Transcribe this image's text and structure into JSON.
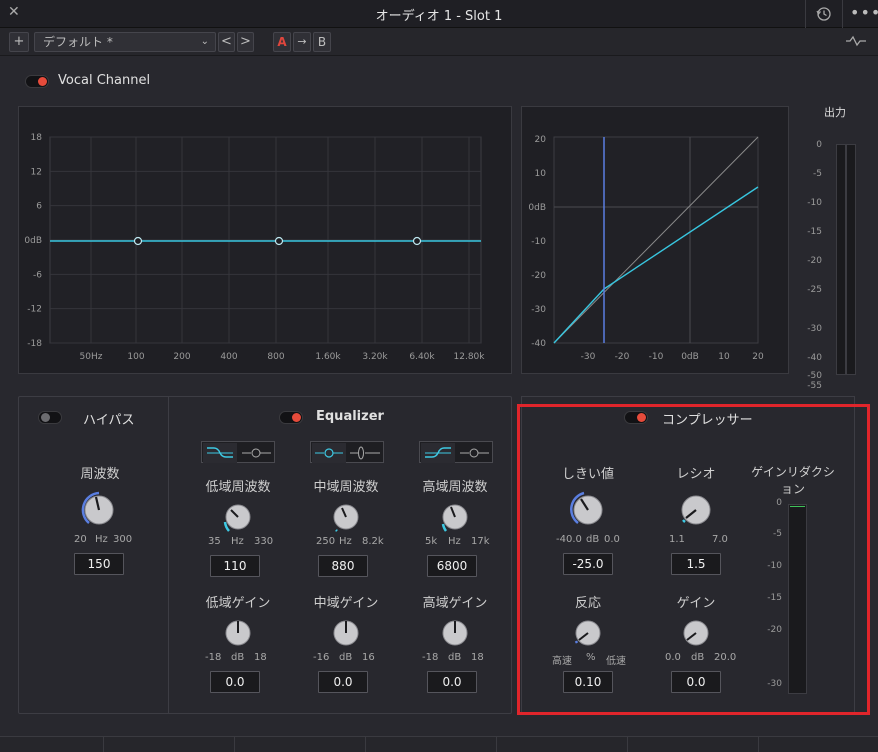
{
  "window": {
    "title": "オーディオ 1 - Slot 1"
  },
  "toolbar": {
    "add_label": "+",
    "preset_value": "デフォルト *",
    "prev_label": "<",
    "next_label": ">",
    "a_label": "A",
    "copy_label": "→",
    "b_label": "B"
  },
  "channel": {
    "name": "Vocal Channel",
    "enabled": true
  },
  "eq_graph": {
    "y_ticks": [
      "18",
      "12",
      "6",
      "0dB",
      "-6",
      "-12",
      "-18"
    ],
    "x_ticks": [
      "50Hz",
      "100",
      "200",
      "400",
      "800",
      "1.60k",
      "3.20k",
      "6.40k",
      "12.80k"
    ]
  },
  "comp_graph": {
    "y_ticks": [
      "20",
      "10",
      "0dB",
      "-10",
      "-20",
      "-30",
      "-40"
    ],
    "x_ticks": [
      "-30",
      "-20",
      "-10",
      "0dB",
      "10",
      "20"
    ]
  },
  "output_meter": {
    "label": "出力",
    "scale": [
      "0",
      "-5",
      "-10",
      "-15",
      "-20",
      "-25",
      "-30",
      "-40",
      "-50",
      "-55"
    ]
  },
  "highpass": {
    "title": "ハイパス",
    "enabled": false,
    "freq_label": "周波数",
    "min": "20",
    "unit": "Hz",
    "max": "300",
    "value": "150"
  },
  "equalizer": {
    "title": "Equalizer",
    "enabled": true,
    "bands": [
      {
        "freq_label": "低域周波数",
        "freq_min": "35",
        "freq_unit": "Hz",
        "freq_max": "330",
        "freq_value": "110",
        "gain_label": "低域ゲイン",
        "gain_min": "-18",
        "gain_unit": "dB",
        "gain_max": "18",
        "gain_value": "0.0"
      },
      {
        "freq_label": "中域周波数",
        "freq_min": "250",
        "freq_unit": "Hz",
        "freq_max": "8.2k",
        "freq_value": "880",
        "gain_label": "中域ゲイン",
        "gain_min": "-16",
        "gain_unit": "dB",
        "gain_max": "16",
        "gain_value": "0.0"
      },
      {
        "freq_label": "高域周波数",
        "freq_min": "5k",
        "freq_unit": "Hz",
        "freq_max": "17k",
        "freq_value": "6800",
        "gain_label": "高域ゲイン",
        "gain_min": "-18",
        "gain_unit": "dB",
        "gain_max": "18",
        "gain_value": "0.0"
      }
    ]
  },
  "compressor": {
    "title": "コンプレッサー",
    "enabled": true,
    "threshold": {
      "label": "しきい値",
      "min": "-40.0",
      "unit": "dB",
      "max": "0.0",
      "value": "-25.0"
    },
    "ratio": {
      "label": "レシオ",
      "min": "1.1",
      "max": "7.0",
      "value": "1.5"
    },
    "response": {
      "label": "反応",
      "min": "高速",
      "unit": "%",
      "max": "低速",
      "value": "0.10"
    },
    "gain": {
      "label": "ゲイン",
      "min": "0.0",
      "unit": "dB",
      "max": "20.0",
      "value": "0.0"
    },
    "reduction": {
      "label": "ゲインリダクション",
      "scale": [
        "0",
        "-5",
        "-10",
        "-15",
        "-20",
        "-30"
      ]
    }
  },
  "colors": {
    "accent": "#4fc3e0",
    "toggle_on": "#e64b3b",
    "highlight_box": "#e0252b",
    "threshold_line": "#5a7ee0"
  }
}
